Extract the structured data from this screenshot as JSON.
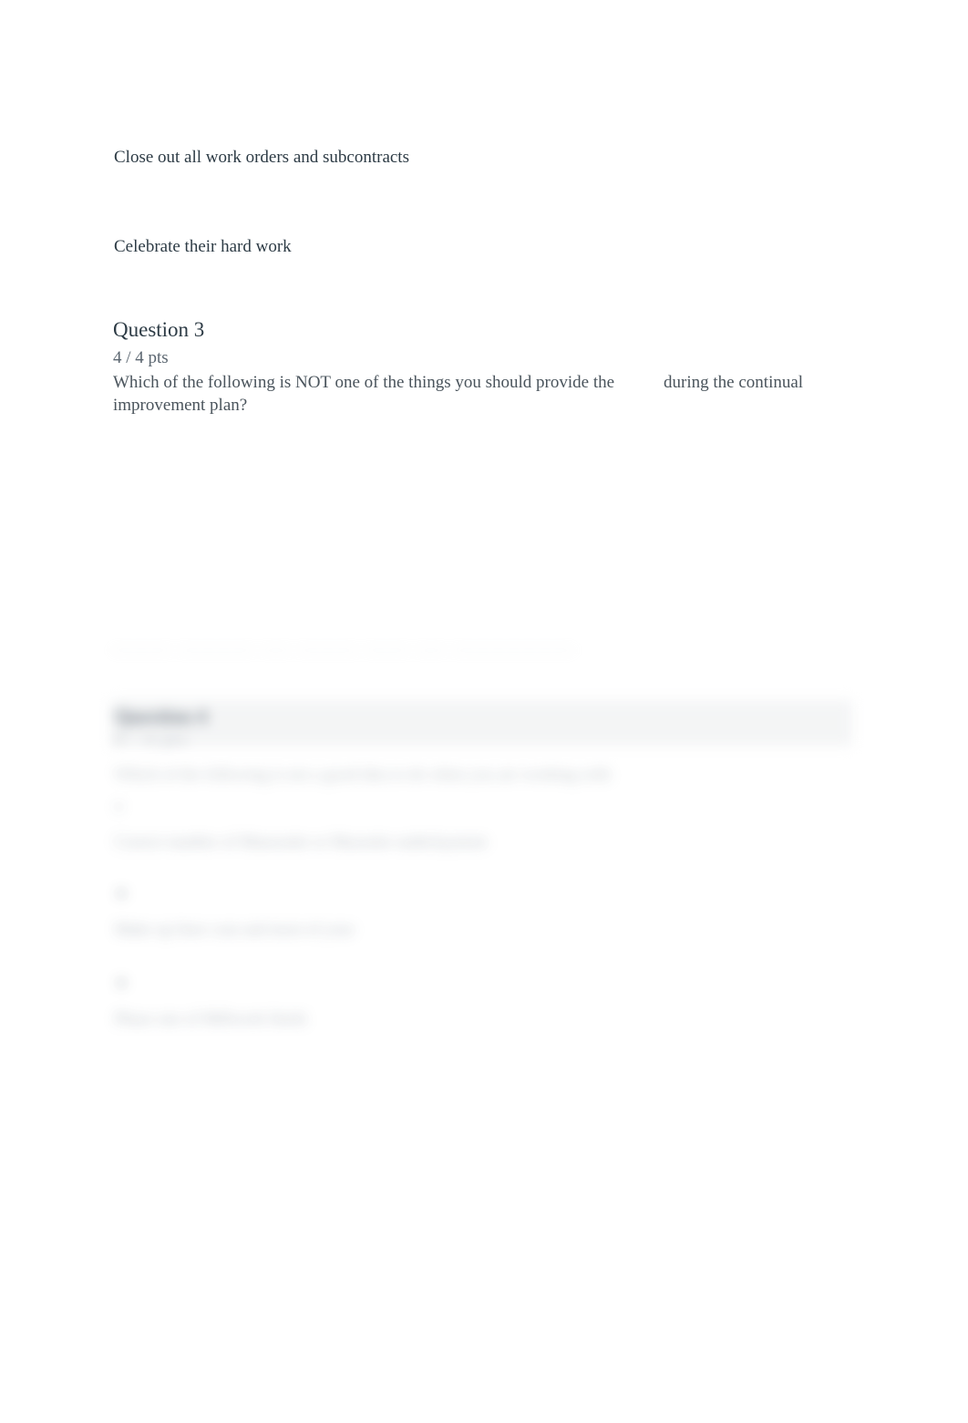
{
  "page": {
    "background_color": "#ffffff",
    "text_color": "#2d3b45",
    "muted_text_color": "#5b6670"
  },
  "answers_above": [
    {
      "label": "Close out all work orders and subcontracts"
    },
    {
      "label": "Celebrate their hard work"
    }
  ],
  "question": {
    "heading": "Question 3",
    "points": "4 / 4 pts",
    "text_before_blank": "Which of the following is NOT one of the things you should provide the",
    "blank": "",
    "text_after_blank": "during the continual improvement plan?"
  },
  "blurred_section": {
    "note": "Content below is rendered out of focus in the screenshot and is not legible.",
    "divider_row": "————  —————  ——  ————  ———  ——  ————————",
    "heading": "Question 4",
    "subheading": "0 / 4 pts",
    "prompt_line_1": "Which of the following is not a good idea to do when you are working with",
    "prompt_line_2": "a",
    "option_marker_1": "●",
    "option_1": "Correct number of Mansonite or Masonite underlayment",
    "option_marker_2": "●",
    "option_2": "Make up liner coat and most of your",
    "option_marker_3": "●",
    "option_3": "Phase one of Millwork finish"
  }
}
